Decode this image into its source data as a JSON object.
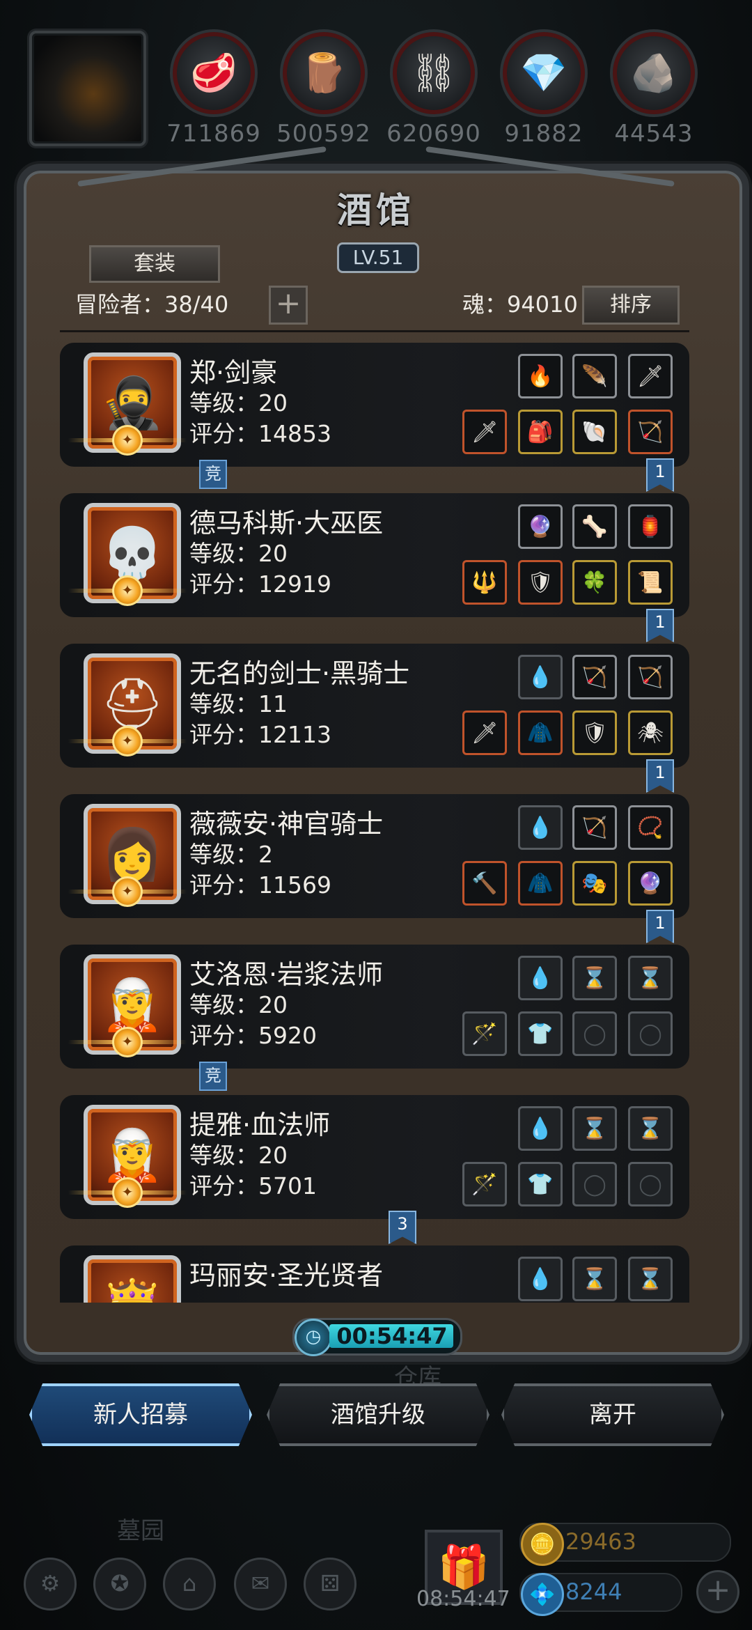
{
  "resources": [
    {
      "icon": "🥩",
      "value": "711869"
    },
    {
      "icon": "🪵",
      "value": "500592"
    },
    {
      "icon": "⛓",
      "value": "620690"
    },
    {
      "icon": "💎",
      "value": "91882"
    },
    {
      "icon": "🪨",
      "value": "44543"
    }
  ],
  "panel": {
    "title": "酒馆",
    "level": "LV.51",
    "suit_button": "套装",
    "adventurers_label": "冒险者：38/40",
    "plus": "+",
    "soul_label": "魂：94010",
    "sort_button": "排序"
  },
  "heroes": [
    {
      "name": "郑·剑豪",
      "level": "等级：20",
      "score": "评分：14853",
      "portrait_icon": "🥷",
      "tag_jing": "竞",
      "flag": "1",
      "top": [
        "🔥",
        "🪶",
        "🗡"
      ],
      "bottom": [
        "🗡",
        "🎒",
        "🐚",
        "🏹"
      ]
    },
    {
      "name": "德马科斯·大巫医",
      "level": "等级：20",
      "score": "评分：12919",
      "portrait_icon": "💀",
      "tag_jing": "",
      "flag": "1",
      "top": [
        "🔮",
        "🦴",
        "🏮"
      ],
      "bottom": [
        "🔱",
        "🛡",
        "🍀",
        "📜"
      ]
    },
    {
      "name": "无名的剑士·黑骑士",
      "level": "等级：11",
      "score": "评分：12113",
      "portrait_icon": "⛑",
      "tag_jing": "",
      "flag": "1",
      "top": [
        "💧",
        "🏹",
        "🏹"
      ],
      "bottom": [
        "🗡",
        "🧥",
        "🛡",
        "🕷"
      ]
    },
    {
      "name": "薇薇安·神官骑士",
      "level": "等级：2",
      "score": "评分：11569",
      "portrait_icon": "👩",
      "tag_jing": "",
      "flag": "1",
      "top": [
        "💧",
        "🏹",
        "📿"
      ],
      "bottom": [
        "🔨",
        "🧥",
        "🎭",
        "🔮"
      ]
    },
    {
      "name": "艾洛恩·岩浆法师",
      "level": "等级：20",
      "score": "评分：5920",
      "portrait_icon": "🧝",
      "tag_jing": "竞",
      "flag": "",
      "top": [
        "💧",
        "⌛",
        "⌛"
      ],
      "bottom": [
        "🪄",
        "👕",
        "◯",
        "◯"
      ]
    },
    {
      "name": "提雅·血法师",
      "level": "等级：20",
      "score": "评分：5701",
      "portrait_icon": "🧝",
      "tag_jing": "",
      "flag": "3",
      "top": [
        "💧",
        "⌛",
        "⌛"
      ],
      "bottom": [
        "🪄",
        "👕",
        "◯",
        "◯"
      ]
    },
    {
      "name": "玛丽安·圣光贤者",
      "level": "",
      "score": "",
      "portrait_icon": "👸",
      "tag_jing": "",
      "flag": "",
      "top": [
        "💧",
        "⌛",
        "⌛"
      ],
      "bottom": []
    }
  ],
  "timer": "00:54:47",
  "ghost_warehouse": "仓库",
  "buttons": {
    "recruit": "新人招募",
    "upgrade": "酒馆升级",
    "leave": "离开"
  },
  "hud": {
    "graveyard": "墓园",
    "time": "08:54:47",
    "gold": "29463",
    "gems": "8244",
    "plus": "+"
  }
}
